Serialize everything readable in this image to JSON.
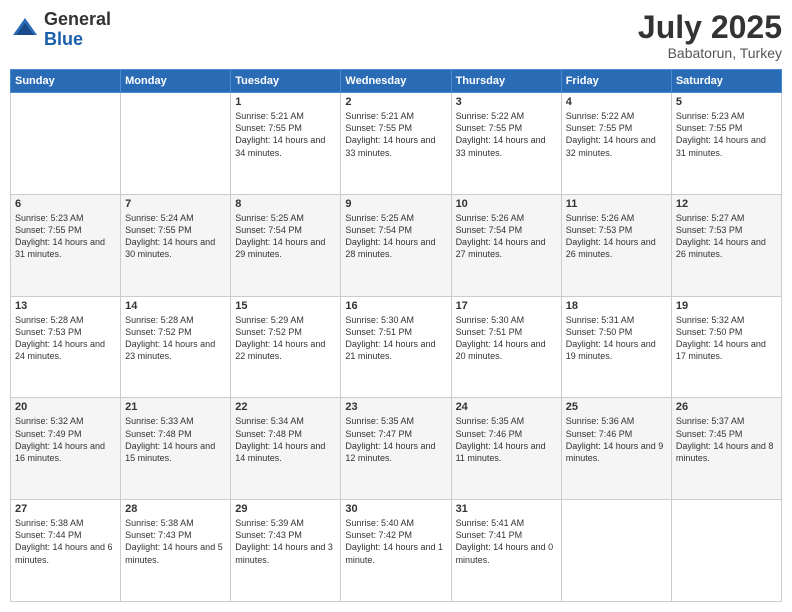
{
  "logo": {
    "general": "General",
    "blue": "Blue"
  },
  "header": {
    "month_year": "July 2025",
    "location": "Babatorun, Turkey"
  },
  "days_of_week": [
    "Sunday",
    "Monday",
    "Tuesday",
    "Wednesday",
    "Thursday",
    "Friday",
    "Saturday"
  ],
  "weeks": [
    [
      {
        "day": "",
        "content": ""
      },
      {
        "day": "",
        "content": ""
      },
      {
        "day": "1",
        "content": "Sunrise: 5:21 AM\nSunset: 7:55 PM\nDaylight: 14 hours\nand 34 minutes."
      },
      {
        "day": "2",
        "content": "Sunrise: 5:21 AM\nSunset: 7:55 PM\nDaylight: 14 hours\nand 33 minutes."
      },
      {
        "day": "3",
        "content": "Sunrise: 5:22 AM\nSunset: 7:55 PM\nDaylight: 14 hours\nand 33 minutes."
      },
      {
        "day": "4",
        "content": "Sunrise: 5:22 AM\nSunset: 7:55 PM\nDaylight: 14 hours\nand 32 minutes."
      },
      {
        "day": "5",
        "content": "Sunrise: 5:23 AM\nSunset: 7:55 PM\nDaylight: 14 hours\nand 31 minutes."
      }
    ],
    [
      {
        "day": "6",
        "content": "Sunrise: 5:23 AM\nSunset: 7:55 PM\nDaylight: 14 hours\nand 31 minutes."
      },
      {
        "day": "7",
        "content": "Sunrise: 5:24 AM\nSunset: 7:55 PM\nDaylight: 14 hours\nand 30 minutes."
      },
      {
        "day": "8",
        "content": "Sunrise: 5:25 AM\nSunset: 7:54 PM\nDaylight: 14 hours\nand 29 minutes."
      },
      {
        "day": "9",
        "content": "Sunrise: 5:25 AM\nSunset: 7:54 PM\nDaylight: 14 hours\nand 28 minutes."
      },
      {
        "day": "10",
        "content": "Sunrise: 5:26 AM\nSunset: 7:54 PM\nDaylight: 14 hours\nand 27 minutes."
      },
      {
        "day": "11",
        "content": "Sunrise: 5:26 AM\nSunset: 7:53 PM\nDaylight: 14 hours\nand 26 minutes."
      },
      {
        "day": "12",
        "content": "Sunrise: 5:27 AM\nSunset: 7:53 PM\nDaylight: 14 hours\nand 26 minutes."
      }
    ],
    [
      {
        "day": "13",
        "content": "Sunrise: 5:28 AM\nSunset: 7:53 PM\nDaylight: 14 hours\nand 24 minutes."
      },
      {
        "day": "14",
        "content": "Sunrise: 5:28 AM\nSunset: 7:52 PM\nDaylight: 14 hours\nand 23 minutes."
      },
      {
        "day": "15",
        "content": "Sunrise: 5:29 AM\nSunset: 7:52 PM\nDaylight: 14 hours\nand 22 minutes."
      },
      {
        "day": "16",
        "content": "Sunrise: 5:30 AM\nSunset: 7:51 PM\nDaylight: 14 hours\nand 21 minutes."
      },
      {
        "day": "17",
        "content": "Sunrise: 5:30 AM\nSunset: 7:51 PM\nDaylight: 14 hours\nand 20 minutes."
      },
      {
        "day": "18",
        "content": "Sunrise: 5:31 AM\nSunset: 7:50 PM\nDaylight: 14 hours\nand 19 minutes."
      },
      {
        "day": "19",
        "content": "Sunrise: 5:32 AM\nSunset: 7:50 PM\nDaylight: 14 hours\nand 17 minutes."
      }
    ],
    [
      {
        "day": "20",
        "content": "Sunrise: 5:32 AM\nSunset: 7:49 PM\nDaylight: 14 hours\nand 16 minutes."
      },
      {
        "day": "21",
        "content": "Sunrise: 5:33 AM\nSunset: 7:48 PM\nDaylight: 14 hours\nand 15 minutes."
      },
      {
        "day": "22",
        "content": "Sunrise: 5:34 AM\nSunset: 7:48 PM\nDaylight: 14 hours\nand 14 minutes."
      },
      {
        "day": "23",
        "content": "Sunrise: 5:35 AM\nSunset: 7:47 PM\nDaylight: 14 hours\nand 12 minutes."
      },
      {
        "day": "24",
        "content": "Sunrise: 5:35 AM\nSunset: 7:46 PM\nDaylight: 14 hours\nand 11 minutes."
      },
      {
        "day": "25",
        "content": "Sunrise: 5:36 AM\nSunset: 7:46 PM\nDaylight: 14 hours\nand 9 minutes."
      },
      {
        "day": "26",
        "content": "Sunrise: 5:37 AM\nSunset: 7:45 PM\nDaylight: 14 hours\nand 8 minutes."
      }
    ],
    [
      {
        "day": "27",
        "content": "Sunrise: 5:38 AM\nSunset: 7:44 PM\nDaylight: 14 hours\nand 6 minutes."
      },
      {
        "day": "28",
        "content": "Sunrise: 5:38 AM\nSunset: 7:43 PM\nDaylight: 14 hours\nand 5 minutes."
      },
      {
        "day": "29",
        "content": "Sunrise: 5:39 AM\nSunset: 7:43 PM\nDaylight: 14 hours\nand 3 minutes."
      },
      {
        "day": "30",
        "content": "Sunrise: 5:40 AM\nSunset: 7:42 PM\nDaylight: 14 hours\nand 1 minute."
      },
      {
        "day": "31",
        "content": "Sunrise: 5:41 AM\nSunset: 7:41 PM\nDaylight: 14 hours\nand 0 minutes."
      },
      {
        "day": "",
        "content": ""
      },
      {
        "day": "",
        "content": ""
      }
    ]
  ]
}
